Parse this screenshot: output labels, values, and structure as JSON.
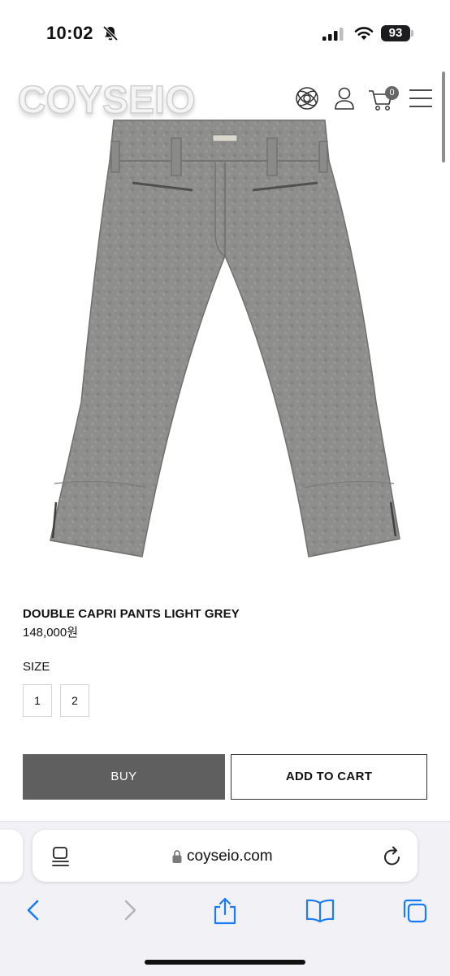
{
  "status_bar": {
    "time": "10:02",
    "battery": "93",
    "bell_icon": "bell-slash-icon"
  },
  "header": {
    "logo": "COYSEIO",
    "icons": [
      "globe-icon",
      "user-icon",
      "cart-icon",
      "menu-icon"
    ],
    "cart_count": "0"
  },
  "product": {
    "image_icon": "pants-image",
    "name": "DOUBLE CAPRI PANTS LIGHT GREY",
    "price": "148,000원",
    "size_label": "SIZE",
    "sizes": [
      "1",
      "2"
    ],
    "buy_label": "BUY",
    "add_to_cart_label": "ADD TO CART",
    "product_color": "#8d8d8b"
  },
  "browser": {
    "url": "coyseio.com",
    "toolbar_icons": [
      "back-icon",
      "forward-icon",
      "share-icon",
      "bookmarks-icon",
      "tabs-icon"
    ],
    "accent": "#1a7cf5"
  }
}
